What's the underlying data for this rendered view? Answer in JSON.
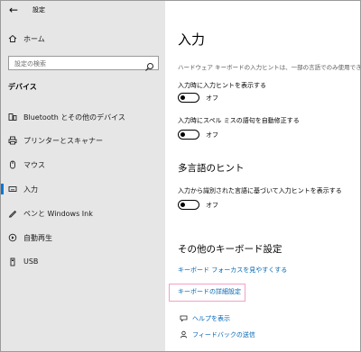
{
  "window": {
    "title": "設定"
  },
  "sidebar": {
    "home_label": "ホーム",
    "search_placeholder": "設定の検索",
    "section_label": "デバイス",
    "items": [
      {
        "label": "Bluetooth とその他のデバイス",
        "icon": "bluetooth-devices-icon"
      },
      {
        "label": "プリンターとスキャナー",
        "icon": "printer-icon"
      },
      {
        "label": "マウス",
        "icon": "mouse-icon"
      },
      {
        "label": "入力",
        "icon": "keyboard-icon",
        "selected": true
      },
      {
        "label": "ペンと Windows Ink",
        "icon": "pen-icon"
      },
      {
        "label": "自動再生",
        "icon": "autoplay-icon"
      },
      {
        "label": "USB",
        "icon": "usb-icon"
      }
    ]
  },
  "main": {
    "title": "入力",
    "description": "ハードウェア キーボードの入力ヒントは、一部の言語でのみ使用でき",
    "settings": [
      {
        "label": "入力時に入力ヒントを表示する",
        "state": "オフ"
      },
      {
        "label": "入力時にスペル ミスの語句を自動修正する",
        "state": "オフ"
      }
    ],
    "multilingual": {
      "title": "多言語のヒント",
      "label": "入力から識別された言語に基づいて入力ヒントを表示する",
      "state": "オフ"
    },
    "other_keyboard": {
      "title": "その他のキーボード設定",
      "link1": "キーボード フォーカスを見やすくする",
      "link2": "キーボードの詳細設定"
    },
    "help": {
      "help_label": "ヘルプを表示",
      "feedback_label": "フィードバックの送信"
    }
  },
  "colors": {
    "accent": "#0078d7",
    "link": "#0066b4",
    "sidebar_bg": "#e6e6e6",
    "highlight": "#f2a0c8"
  }
}
